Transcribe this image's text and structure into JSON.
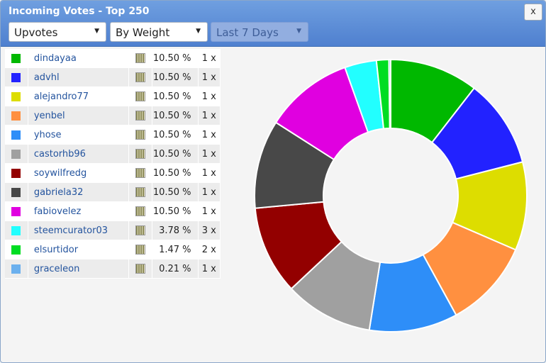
{
  "window": {
    "title": "Incoming Votes - Top 250",
    "close_label": "x"
  },
  "filters": {
    "type": {
      "value": "Upvotes"
    },
    "sort": {
      "value": "By Weight"
    },
    "period": {
      "value": "Last 7 Days",
      "disabled": true
    }
  },
  "voters": [
    {
      "name": "dindayaa",
      "percent": "10.50 %",
      "count": "1 x",
      "color": "#00b800"
    },
    {
      "name": "advhl",
      "percent": "10.50 %",
      "count": "1 x",
      "color": "#2222ff"
    },
    {
      "name": "alejandro77",
      "percent": "10.50 %",
      "count": "1 x",
      "color": "#dddd00"
    },
    {
      "name": "yenbel",
      "percent": "10.50 %",
      "count": "1 x",
      "color": "#ff9040"
    },
    {
      "name": "yhose",
      "percent": "10.50 %",
      "count": "1 x",
      "color": "#2e8ef8"
    },
    {
      "name": "castorhb96",
      "percent": "10.50 %",
      "count": "1 x",
      "color": "#a0a0a0"
    },
    {
      "name": "soywilfredg",
      "percent": "10.50 %",
      "count": "1 x",
      "color": "#930000"
    },
    {
      "name": "gabriela32",
      "percent": "10.50 %",
      "count": "1 x",
      "color": "#484848"
    },
    {
      "name": "fabiovelez",
      "percent": "10.50 %",
      "count": "1 x",
      "color": "#e000e0"
    },
    {
      "name": "steemcurator03",
      "percent": "3.78 %",
      "count": "3 x",
      "color": "#22ffff"
    },
    {
      "name": "elsurtidor",
      "percent": "1.47 %",
      "count": "2 x",
      "color": "#00dd22"
    },
    {
      "name": "graceleon",
      "percent": "0.21 %",
      "count": "1 x",
      "color": "#6bb0ee"
    }
  ],
  "chart_data": {
    "type": "pie",
    "donut": true,
    "categories": [
      "dindayaa",
      "advhl",
      "alejandro77",
      "yenbel",
      "yhose",
      "castorhb96",
      "soywilfredg",
      "gabriela32",
      "fabiovelez",
      "steemcurator03",
      "elsurtidor",
      "graceleon"
    ],
    "values": [
      10.5,
      10.5,
      10.5,
      10.5,
      10.5,
      10.5,
      10.5,
      10.5,
      10.5,
      3.78,
      1.47,
      0.21
    ],
    "colors": [
      "#00b800",
      "#2222ff",
      "#dddd00",
      "#ff9040",
      "#2e8ef8",
      "#a0a0a0",
      "#930000",
      "#484848",
      "#e000e0",
      "#22ffff",
      "#00dd22",
      "#6bb0ee"
    ]
  }
}
